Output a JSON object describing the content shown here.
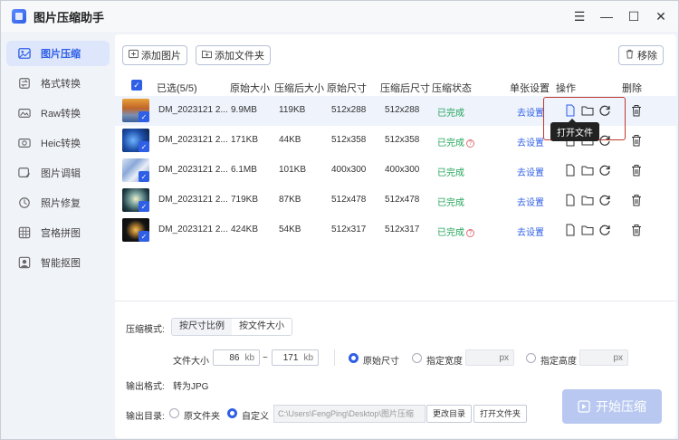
{
  "app": {
    "title": "图片压缩助手"
  },
  "window_controls": {
    "menu": "☰",
    "minimize": "—",
    "maximize": "☐",
    "close": "✕"
  },
  "sidebar": {
    "items": [
      {
        "label": "图片压缩",
        "icon": "image-compress-icon"
      },
      {
        "label": "格式转换",
        "icon": "format-convert-icon"
      },
      {
        "label": "Raw转换",
        "icon": "raw-convert-icon"
      },
      {
        "label": "Heic转换",
        "icon": "heic-convert-icon"
      },
      {
        "label": "图片调辑",
        "icon": "image-edit-icon"
      },
      {
        "label": "照片修复",
        "icon": "photo-repair-icon"
      },
      {
        "label": "宫格拼图",
        "icon": "grid-collage-icon"
      },
      {
        "label": "智能抠图",
        "icon": "smart-cutout-icon"
      }
    ]
  },
  "toolbar": {
    "add_image": "添加图片",
    "add_folder": "添加文件夹",
    "remove": "移除"
  },
  "table": {
    "headers": {
      "selected": "已选(5/5)",
      "orig_size": "原始大小",
      "comp_size": "压缩后大小",
      "orig_dim": "原始尺寸",
      "comp_dim": "压缩后尺寸",
      "status": "压缩状态",
      "settings": "单张设置",
      "actions": "操作",
      "delete": "删除"
    },
    "rows": [
      {
        "name": "DM_2023121 2...",
        "orig_size": "9.9MB",
        "comp_size": "119KB",
        "orig_dim": "512x288",
        "comp_dim": "512x288",
        "status": "已完成",
        "warn": false,
        "setting": "去设置"
      },
      {
        "name": "DM_2023121 2...",
        "orig_size": "171KB",
        "comp_size": "44KB",
        "orig_dim": "512x358",
        "comp_dim": "512x358",
        "status": "已完成",
        "warn": true,
        "setting": "去设置"
      },
      {
        "name": "DM_2023121 2...",
        "orig_size": "6.1MB",
        "comp_size": "101KB",
        "orig_dim": "400x300",
        "comp_dim": "400x300",
        "status": "已完成",
        "warn": false,
        "setting": "去设置"
      },
      {
        "name": "DM_2023121 2...",
        "orig_size": "719KB",
        "comp_size": "87KB",
        "orig_dim": "512x478",
        "comp_dim": "512x478",
        "status": "已完成",
        "warn": false,
        "setting": "去设置"
      },
      {
        "name": "DM_2023121 2...",
        "orig_size": "424KB",
        "comp_size": "54KB",
        "orig_dim": "512x317",
        "comp_dim": "512x317",
        "status": "已完成",
        "warn": true,
        "setting": "去设置"
      }
    ],
    "tooltip": "打开文件"
  },
  "settings": {
    "mode_label": "压缩模式:",
    "mode_options": [
      "按尺寸比例",
      "按文件大小"
    ],
    "file_size_label": "文件大小",
    "size_min": "86",
    "size_max": "171",
    "size_unit": "kb",
    "tilde": "~",
    "dim_options": [
      "原始尺寸",
      "指定宽度",
      "指定高度"
    ],
    "px_unit": "px",
    "output_format_label": "输出格式:",
    "output_format_value": "转为JPG",
    "output_dir_label": "输出目录:",
    "dir_options": [
      "原文件夹",
      "自定义"
    ],
    "dir_path": "C:\\Users\\FengPing\\Desktop\\图片压缩",
    "change_dir": "更改目录",
    "open_folder": "打开文件夹",
    "start": "开始压缩"
  },
  "colors": {
    "accent": "#2f5fe6",
    "success": "#22a55a",
    "highlight_border": "#c0392b"
  }
}
